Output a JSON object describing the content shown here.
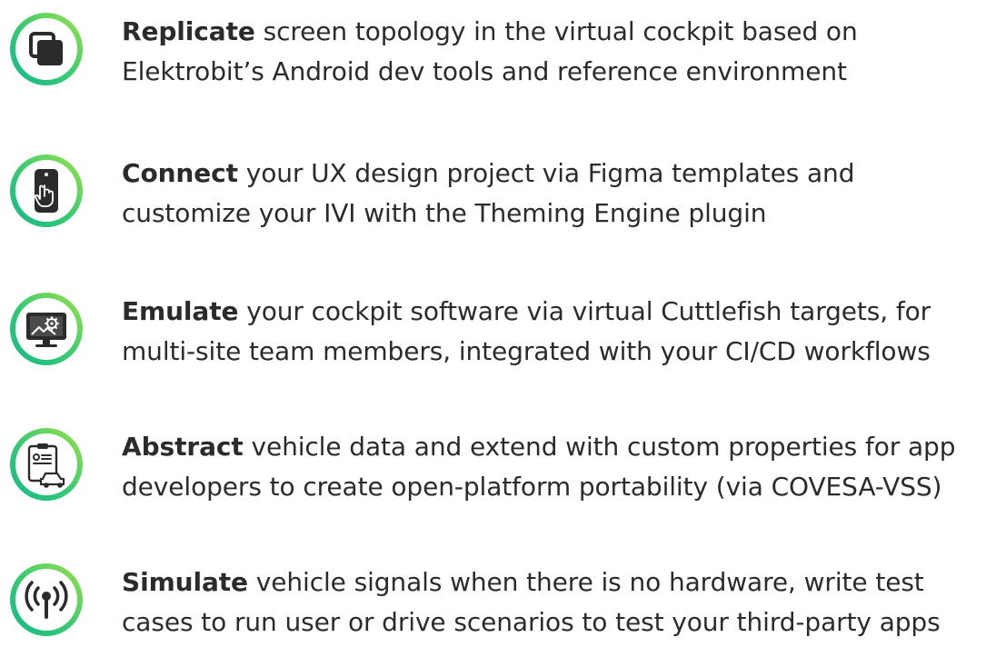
{
  "colors": {
    "ring_gradient_start": "#9be24a",
    "ring_gradient_mid": "#3ccb70",
    "ring_gradient_end": "#13b88b",
    "icon_dark": "#2b2b2b",
    "text": "#2b2b2b"
  },
  "features": [
    {
      "icon": "overlapping-squares-icon",
      "lead": "Replicate",
      "line1": "screen topology in the virtual cockpit based on",
      "line2": "Elektrobit’s Android dev tools and reference environment"
    },
    {
      "icon": "smartphone-touch-icon",
      "lead": "Connect",
      "line1": "your UX design project via Figma templates and",
      "line2": "customize your IVI with the Theming Engine plugin"
    },
    {
      "icon": "monitor-gear-icon",
      "lead": "Emulate",
      "line1": "your cockpit software via virtual Cuttlefish targets, for",
      "line2": "multi-site team members, integrated with your CI/CD workflows"
    },
    {
      "icon": "clipboard-car-icon",
      "lead": "Abstract",
      "line1": "vehicle data and extend with custom properties for app",
      "line2": "developers to create open-platform portability (via COVESA-VSS)"
    },
    {
      "icon": "broadcast-signal-icon",
      "lead": "Simulate",
      "line1": "vehicle signals when there is no hardware, write test",
      "line2": "cases to run user or drive scenarios to test your third-party apps"
    }
  ]
}
